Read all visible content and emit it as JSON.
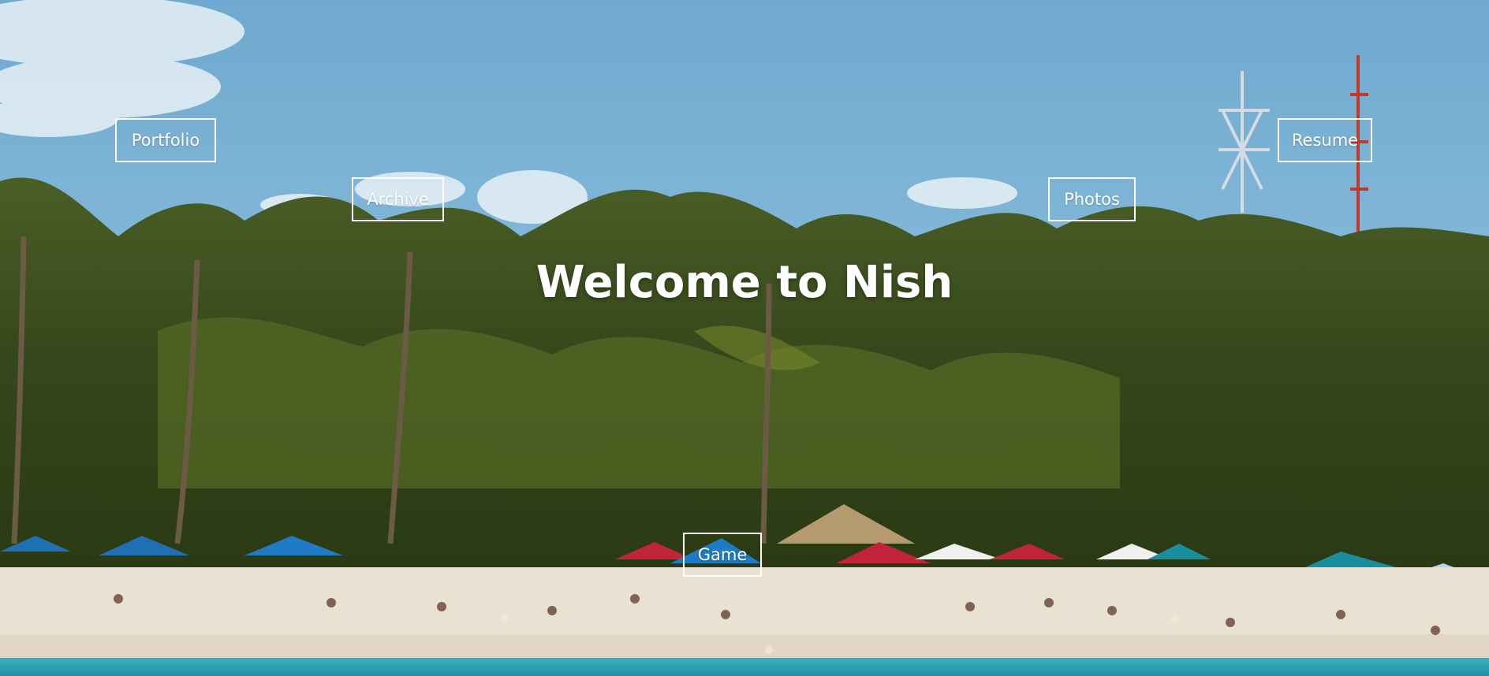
{
  "hero": {
    "title": "Welcome to Nish",
    "background": "tropical-beach-photo"
  },
  "nav": {
    "portfolio": "Portfolio",
    "archive": "Archive",
    "photos": "Photos",
    "resume": "Resume",
    "game": "Game"
  },
  "colors": {
    "sky": "#7fb6d8",
    "palm": "#3b4d1e",
    "sand": "#e9e3d5",
    "water": "#2aa3b5",
    "text": "#ffffff"
  }
}
